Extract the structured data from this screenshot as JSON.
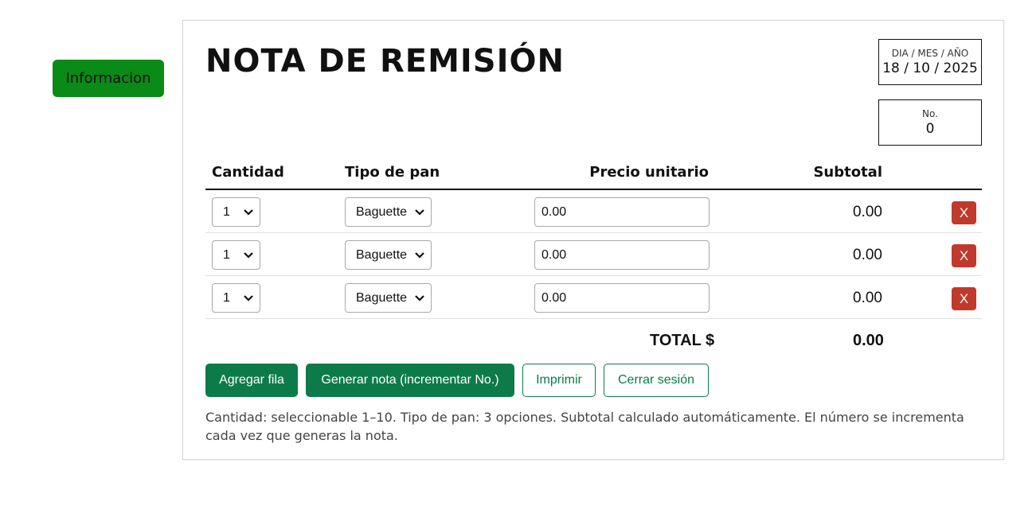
{
  "sidebar": {
    "info_button": "Informacion"
  },
  "header": {
    "title": "NOTA DE REMISIÓN",
    "date_label": "DIA / MES / AÑO",
    "date_value": "18 / 10 / 2025",
    "number_label": "No.",
    "number_value": "0"
  },
  "table": {
    "columns": [
      "Cantidad",
      "Tipo de pan",
      "Precio unitario",
      "Subtotal"
    ],
    "rows": [
      {
        "cantidad": "1",
        "tipo": "Baguette",
        "precio": "0.00",
        "subtotal": "0.00",
        "delete": "X"
      },
      {
        "cantidad": "1",
        "tipo": "Baguette",
        "precio": "0.00",
        "subtotal": "0.00",
        "delete": "X"
      },
      {
        "cantidad": "1",
        "tipo": "Baguette",
        "precio": "0.00",
        "subtotal": "0.00",
        "delete": "X"
      }
    ],
    "total_label": "TOTAL $",
    "total_value": "0.00"
  },
  "actions": {
    "add_row": "Agregar fila",
    "generate": "Generar nota (incrementar No.)",
    "print": "Imprimir",
    "logout": "Cerrar sesión"
  },
  "note": "Cantidad: seleccionable 1–10. Tipo de pan: 3 opciones. Subtotal calculado automáticamente. El número se incrementa cada vez que generas la nota.",
  "colors": {
    "info_button_bg": "#0a8a16",
    "primary_green": "#0d7b49",
    "delete_red": "#c0392b"
  }
}
